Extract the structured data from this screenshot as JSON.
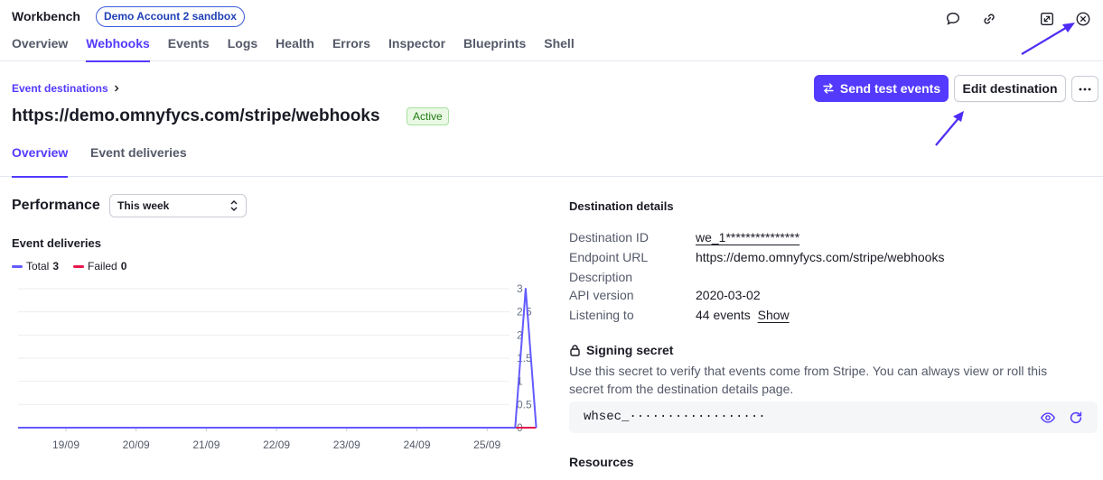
{
  "header": {
    "app_title": "Workbench",
    "sandbox_badge": "Demo Account 2 sandbox",
    "tabs": [
      {
        "label": "Overview"
      },
      {
        "label": "Webhooks"
      },
      {
        "label": "Events"
      },
      {
        "label": "Logs"
      },
      {
        "label": "Health"
      },
      {
        "label": "Errors"
      },
      {
        "label": "Inspector"
      },
      {
        "label": "Blueprints"
      },
      {
        "label": "Shell"
      }
    ],
    "active_tab": "Webhooks",
    "icons": [
      "chat-icon",
      "link-icon",
      "expand-icon",
      "close-icon"
    ]
  },
  "destination": {
    "breadcrumb": "Event destinations",
    "url": "https://demo.omnyfycs.com/stripe/webhooks",
    "status": "Active",
    "send_test_label": "Send test events",
    "edit_label": "Edit destination",
    "more_label": "···"
  },
  "sub_tabs": [
    {
      "label": "Overview"
    },
    {
      "label": "Event deliveries"
    }
  ],
  "performance": {
    "title": "Performance",
    "period": "This week",
    "deliveries_title": "Event deliveries",
    "legend": [
      {
        "label": "Total",
        "value": "3",
        "color": "#635bff"
      },
      {
        "label": "Failed",
        "value": "0",
        "color": "#e5174c"
      }
    ]
  },
  "chart_data": {
    "type": "line",
    "categories": [
      "19/09",
      "20/09",
      "21/09",
      "22/09",
      "23/09",
      "24/09",
      "25/09"
    ],
    "y_ticks": [
      "0",
      "0.5",
      "1",
      "1.5",
      "2",
      "2.5",
      "3"
    ],
    "ylim": [
      0,
      3
    ],
    "grid": true,
    "series": [
      {
        "name": "Total",
        "color": "#635bff",
        "points": [
          [
            0,
            0
          ],
          [
            6.4,
            0
          ],
          [
            6.55,
            3
          ],
          [
            6.7,
            0
          ]
        ]
      },
      {
        "name": "Failed",
        "color": "#e5174c",
        "points": [
          [
            0,
            0
          ],
          [
            6.7,
            0
          ]
        ]
      }
    ]
  },
  "details": {
    "title": "Destination details",
    "rows": [
      {
        "label": "Destination ID",
        "value": "we_1***************"
      },
      {
        "label": "Endpoint URL",
        "value": "https://demo.omnyfycs.com/stripe/webhooks"
      },
      {
        "label": "Description",
        "value": ""
      },
      {
        "label": "API version",
        "value": "2020-03-02"
      },
      {
        "label": "Listening to",
        "value": "44 events",
        "link": "Show"
      }
    ]
  },
  "signing": {
    "title": "Signing secret",
    "description": "Use this secret to verify that events come from Stripe. You can always view or roll this secret from the destination details page.",
    "value": "whsec_··················"
  },
  "resources": {
    "title": "Resources"
  }
}
